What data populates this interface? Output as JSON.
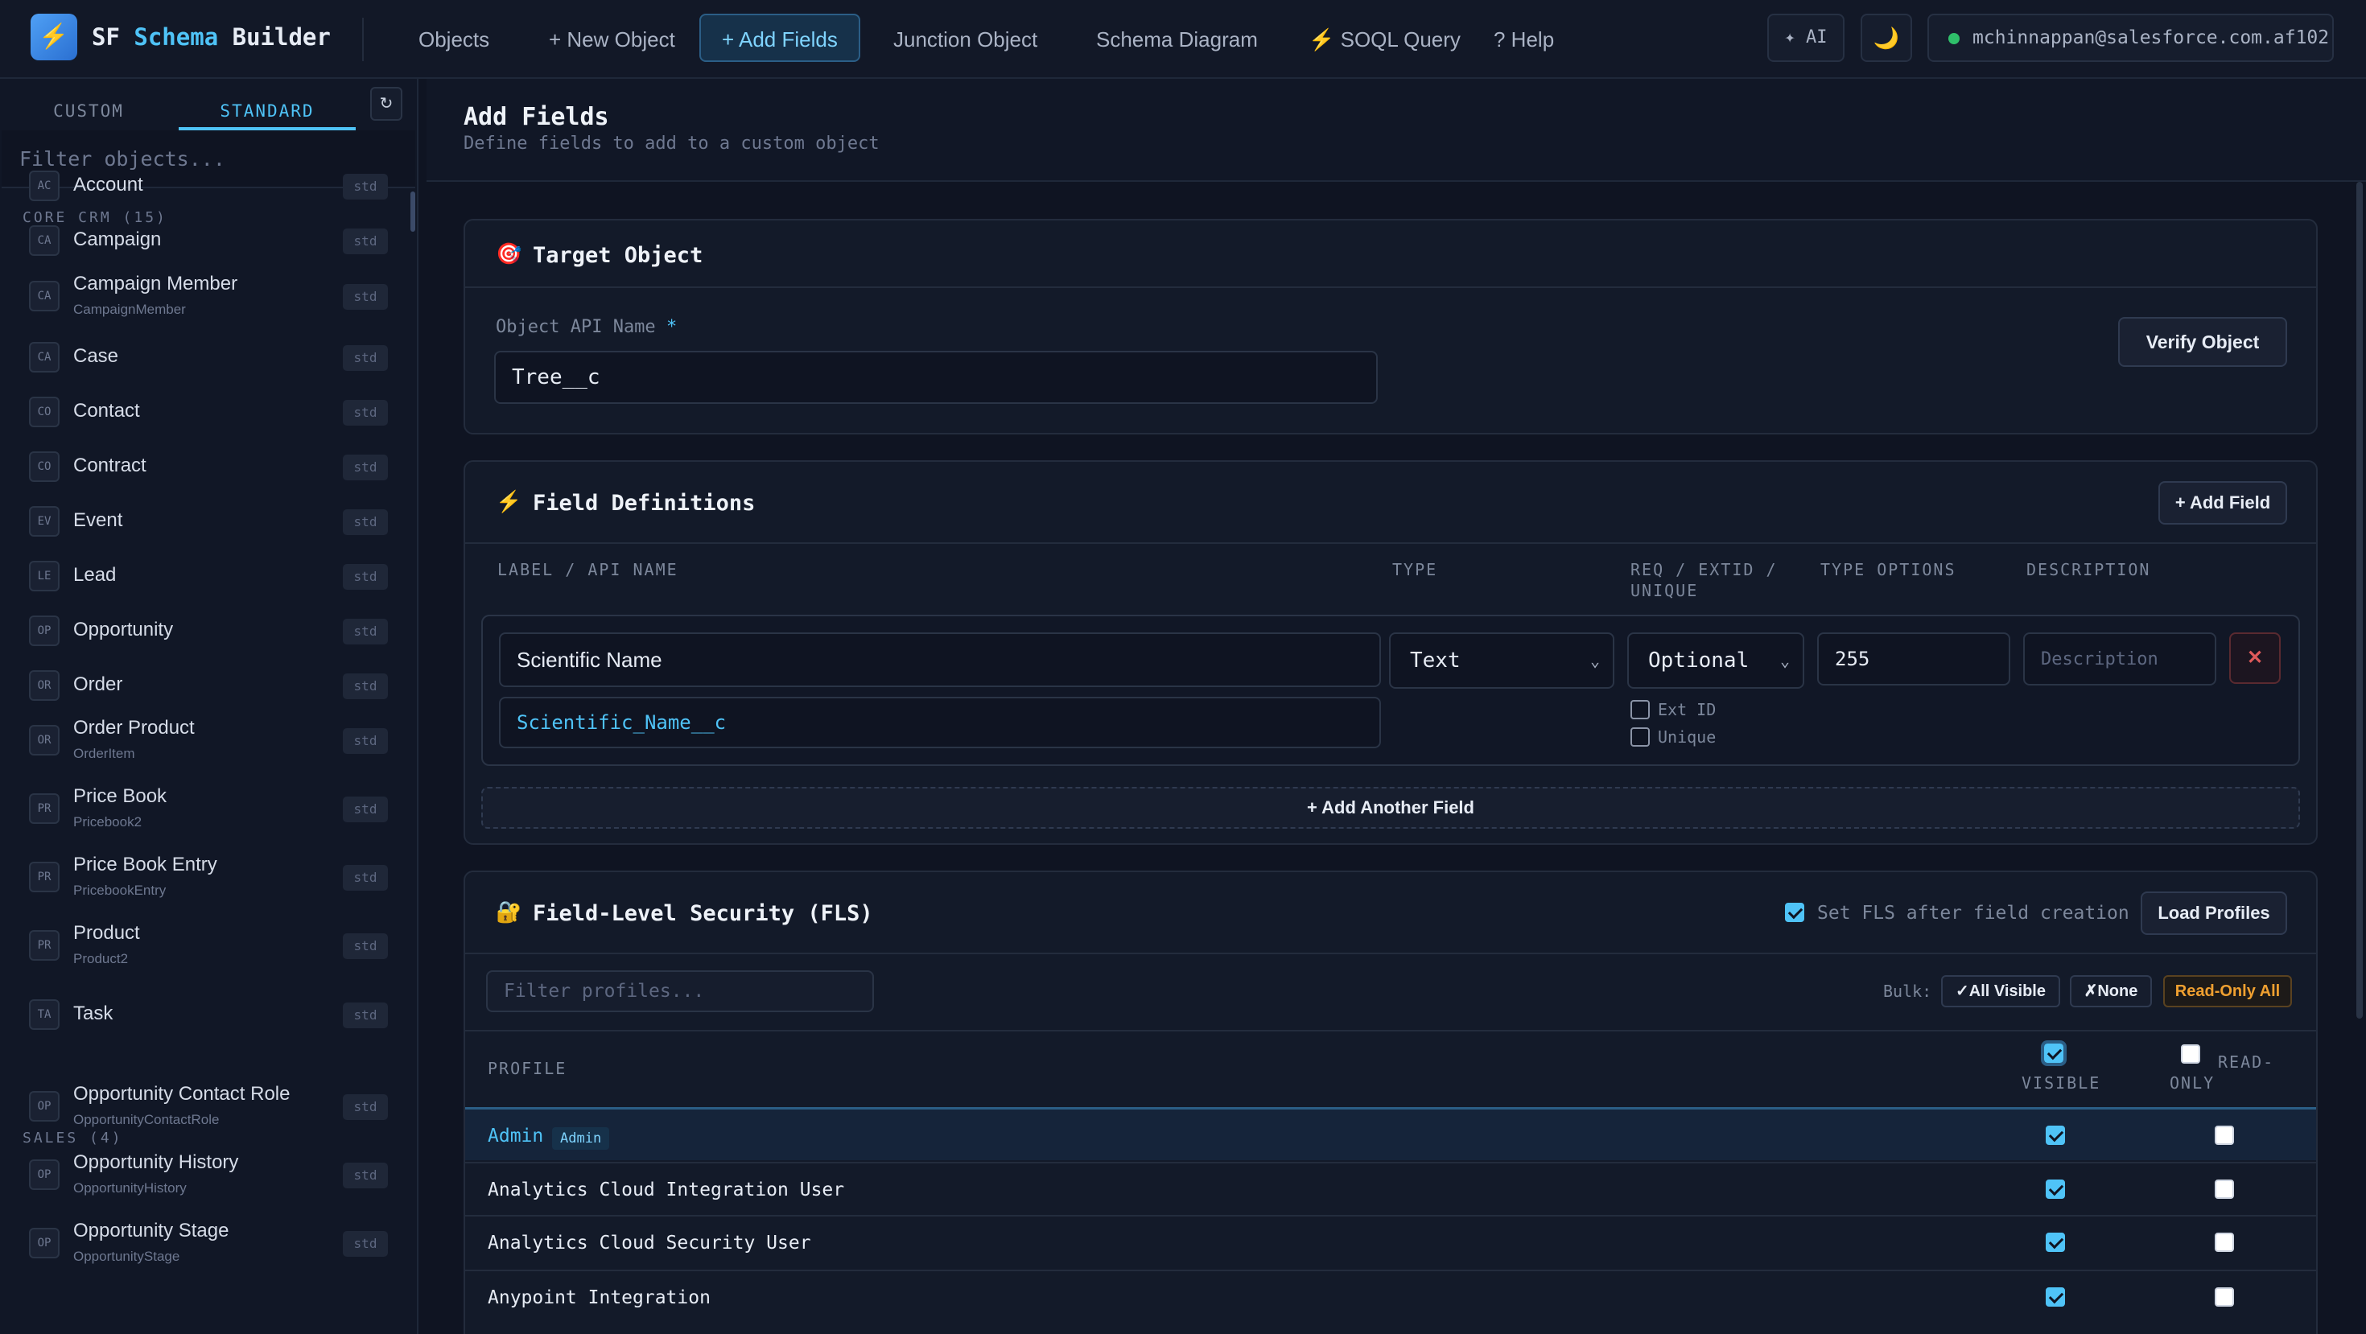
{
  "app": {
    "logo_glyph": "⚡",
    "brand_prefix": "SF",
    "brand_accent": "Schema",
    "brand_suffix": "Builder"
  },
  "nav": {
    "objects": "Objects",
    "new_object": "+ New Object",
    "add_fields": "+ Add Fields",
    "junction": "Junction Object",
    "diagram": "Schema Diagram",
    "soql": "⚡ SOQL Query",
    "help": "? Help"
  },
  "topbar": {
    "ai_label": "✦ AI",
    "theme_glyph": "🌙",
    "user": "mchinnappan@salesforce.com.af102"
  },
  "sidebar": {
    "tab_custom": "CUSTOM",
    "tab_standard": "STANDARD",
    "refresh_glyph": "↻",
    "filter_placeholder": "Filter objects...",
    "group_core": "CORE CRM (15)",
    "group_sales": "SALES (4)",
    "std_badge": "std",
    "core_items": [
      {
        "abbr": "AC",
        "name": "Account",
        "api": ""
      },
      {
        "abbr": "CA",
        "name": "Campaign",
        "api": ""
      },
      {
        "abbr": "CA",
        "name": "Campaign Member",
        "api": "CampaignMember"
      },
      {
        "abbr": "CA",
        "name": "Case",
        "api": ""
      },
      {
        "abbr": "CO",
        "name": "Contact",
        "api": ""
      },
      {
        "abbr": "CO",
        "name": "Contract",
        "api": ""
      },
      {
        "abbr": "EV",
        "name": "Event",
        "api": ""
      },
      {
        "abbr": "LE",
        "name": "Lead",
        "api": ""
      },
      {
        "abbr": "OP",
        "name": "Opportunity",
        "api": ""
      },
      {
        "abbr": "OR",
        "name": "Order",
        "api": ""
      },
      {
        "abbr": "OR",
        "name": "Order Product",
        "api": "OrderItem"
      },
      {
        "abbr": "PR",
        "name": "Price Book",
        "api": "Pricebook2"
      },
      {
        "abbr": "PR",
        "name": "Price Book Entry",
        "api": "PricebookEntry"
      },
      {
        "abbr": "PR",
        "name": "Product",
        "api": "Product2"
      },
      {
        "abbr": "TA",
        "name": "Task",
        "api": ""
      }
    ],
    "sales_items": [
      {
        "abbr": "OP",
        "name": "Opportunity Contact Role",
        "api": "OpportunityContactRole"
      },
      {
        "abbr": "OP",
        "name": "Opportunity History",
        "api": "OpportunityHistory"
      },
      {
        "abbr": "OP",
        "name": "Opportunity Stage",
        "api": "OpportunityStage"
      }
    ]
  },
  "page": {
    "title": "Add Fields",
    "subtitle": "Define fields to add to a custom object"
  },
  "target": {
    "icon": "🎯",
    "title": "Target Object",
    "label": "Object API Name",
    "required_mark": "*",
    "value": "Tree__c",
    "verify_label": "Verify Object"
  },
  "fields": {
    "icon": "⚡",
    "title": "Field Definitions",
    "add_field_label": "+ Add Field",
    "col_label": "LABEL / API NAME",
    "col_type": "TYPE",
    "col_req_1": "REQ / EXTID /",
    "col_req_2": "UNIQUE",
    "col_options": "TYPE OPTIONS",
    "col_desc": "DESCRIPTION",
    "row": {
      "label": "Scientific Name",
      "api_name": "Scientific_Name__c",
      "type": "Text",
      "requirement": "Optional",
      "length": "255",
      "description_placeholder": "Description",
      "ext_id_label": "Ext ID",
      "unique_label": "Unique",
      "remove_glyph": "✕"
    },
    "add_another_label": "+ Add Another Field"
  },
  "fls": {
    "icon": "🔐",
    "title": "Field-Level Security (FLS)",
    "set_after_label": "Set FLS after field creation",
    "load_profiles_label": "Load Profiles",
    "filter_placeholder": "Filter profiles...",
    "bulk_label": "Bulk:",
    "all_visible_label": "✓All Visible",
    "none_label": "✗None",
    "readonly_all_label": "Read-Only All",
    "col_profile": "PROFILE",
    "col_visible": "VISIBLE",
    "col_readonly_1": "READ-",
    "col_readonly_2": "ONLY",
    "admin_badge": "Admin",
    "profiles": [
      {
        "name": "Admin",
        "visible": true,
        "readonly": false
      },
      {
        "name": "Analytics Cloud Integration User",
        "visible": true,
        "readonly": false
      },
      {
        "name": "Analytics Cloud Security User",
        "visible": true,
        "readonly": false
      },
      {
        "name": "Anypoint Integration",
        "visible": true,
        "readonly": false
      }
    ]
  },
  "colors": {
    "accent": "#4fc3f7",
    "background": "#0f1422",
    "panel": "#131a29",
    "warning": "#f0a030",
    "danger": "#e05a5a",
    "online": "#2fbf6a"
  }
}
